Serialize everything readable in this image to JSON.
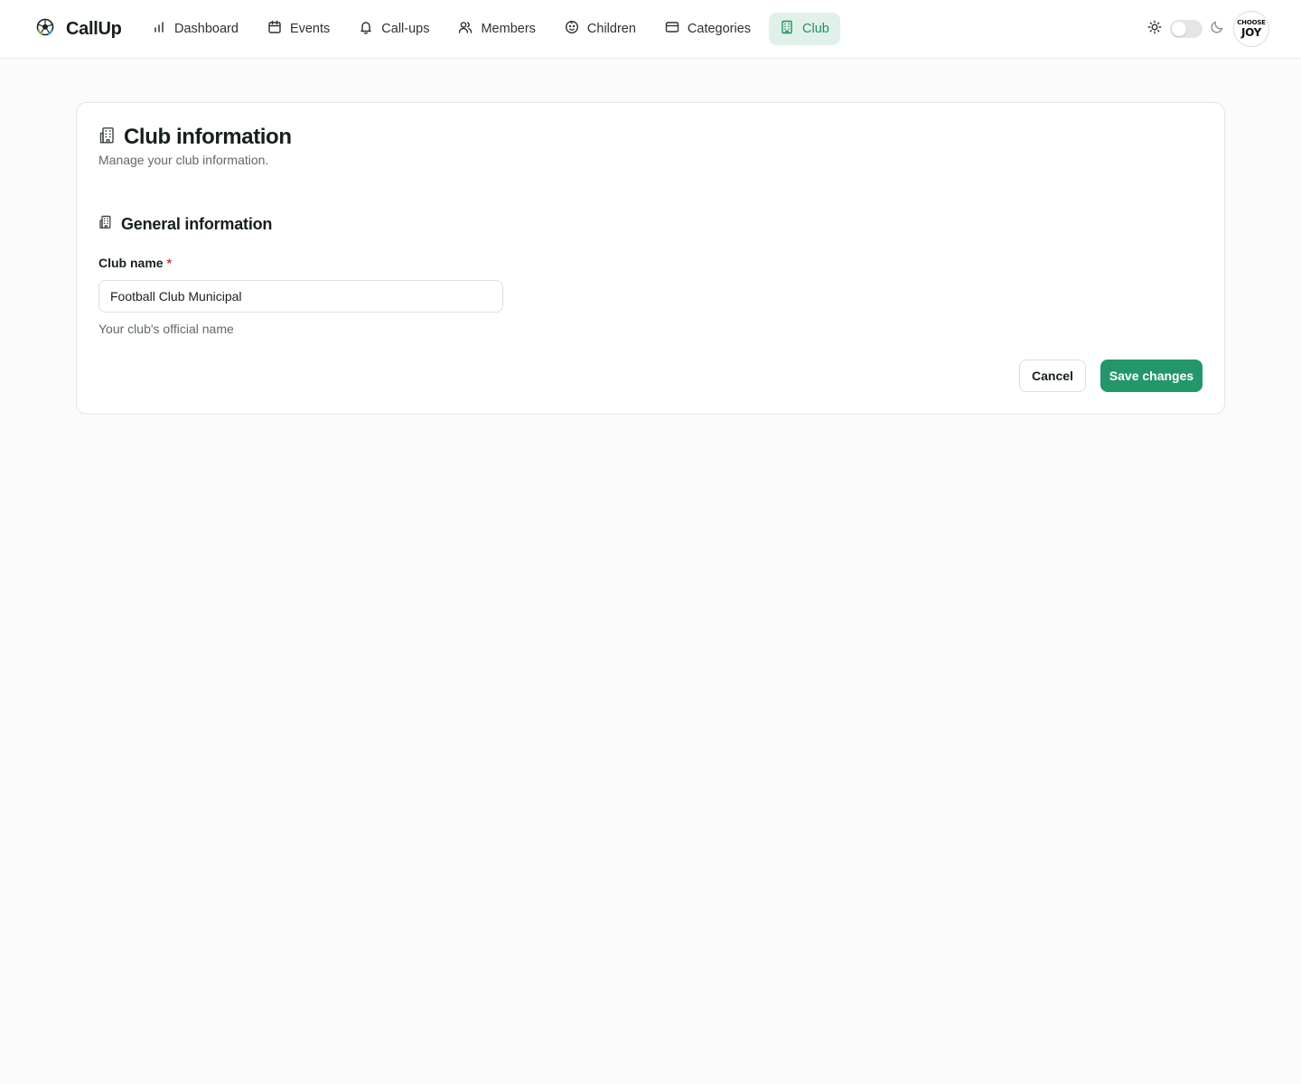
{
  "app": {
    "name": "CallUp"
  },
  "nav": {
    "items": [
      {
        "label": "Dashboard",
        "icon": "bar-chart-icon"
      },
      {
        "label": "Events",
        "icon": "calendar-icon"
      },
      {
        "label": "Call-ups",
        "icon": "bell-icon"
      },
      {
        "label": "Members",
        "icon": "users-icon"
      },
      {
        "label": "Children",
        "icon": "baby-face-icon"
      },
      {
        "label": "Categories",
        "icon": "credit-card-icon"
      },
      {
        "label": "Club",
        "icon": "building-icon",
        "active": true
      }
    ]
  },
  "theme": {
    "mode": "light",
    "light_icon": "sun-icon",
    "dark_icon": "moon-icon"
  },
  "avatar": {
    "line1": "CHOOSE",
    "line2": "JOY"
  },
  "page": {
    "title": "Club information",
    "subtitle": "Manage your club information."
  },
  "section": {
    "title": "General information"
  },
  "form": {
    "club_name": {
      "label": "Club name",
      "required_mark": "*",
      "value": "Football Club Municipal",
      "help": "Your club's official name"
    }
  },
  "actions": {
    "cancel": "Cancel",
    "save": "Save changes"
  },
  "colors": {
    "accent": "#23976a",
    "accent_soft": "#e1f1e9",
    "required": "#d63a3a"
  }
}
